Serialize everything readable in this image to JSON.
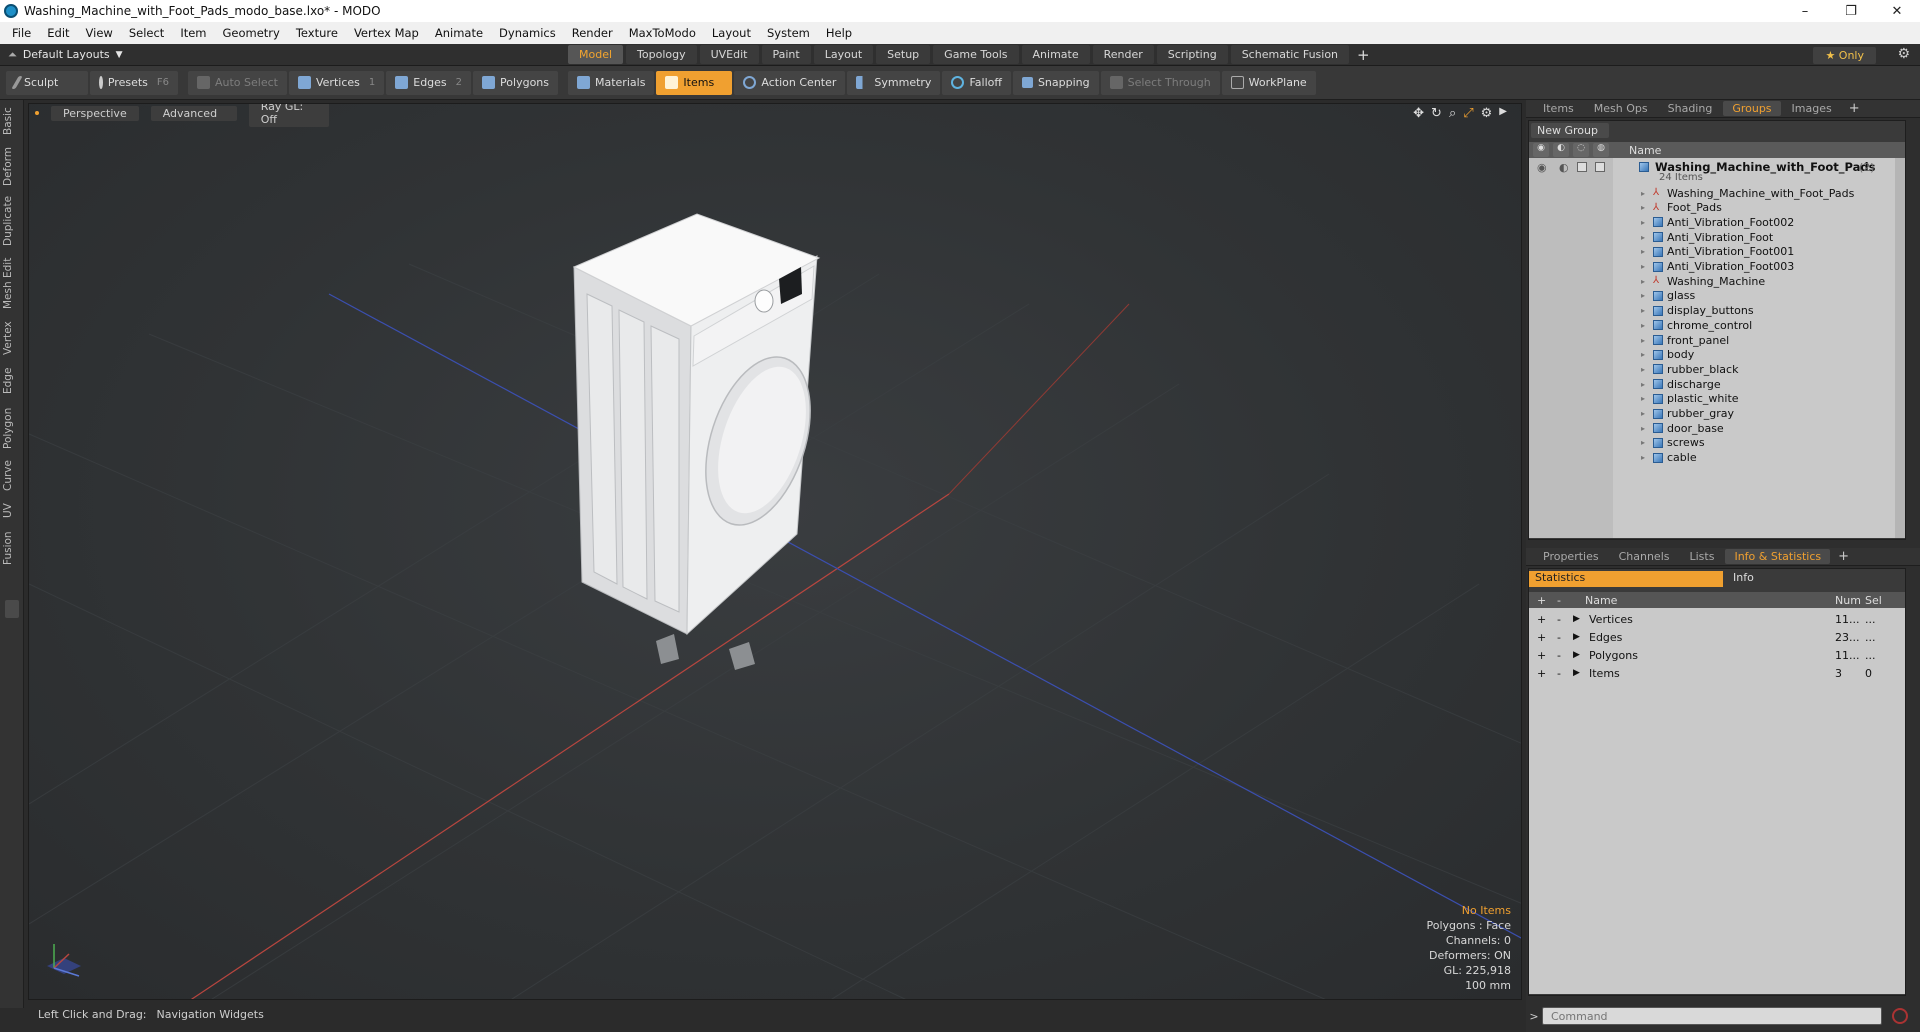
{
  "window": {
    "title": "Washing_Machine_with_Foot_Pads_modo_base.lxo* - MODO",
    "controls": [
      "–",
      "❐",
      "✕"
    ]
  },
  "menu": [
    "File",
    "Edit",
    "View",
    "Select",
    "Item",
    "Geometry",
    "Texture",
    "Vertex Map",
    "Animate",
    "Dynamics",
    "Render",
    "MaxToModo",
    "Layout",
    "System",
    "Help"
  ],
  "layoutbar": {
    "default_layouts": "Default Layouts",
    "tabs": [
      "Model",
      "Topology",
      "UVEdit",
      "Paint",
      "Layout",
      "Setup",
      "Game Tools",
      "Animate",
      "Render",
      "Scripting",
      "Schematic Fusion"
    ],
    "active_tab": "Model",
    "only_label": "★  Only"
  },
  "toolbar": {
    "sculpt": "Sculpt",
    "presets": "Presets",
    "presets_key": "F6",
    "auto_select": "Auto Select",
    "vertices": "Vertices",
    "vertices_key": "1",
    "edges": "Edges",
    "edges_key": "2",
    "polygons": "Polygons",
    "materials": "Materials",
    "items": "Items",
    "action_center": "Action Center",
    "symmetry": "Symmetry",
    "falloff": "Falloff",
    "snapping": "Snapping",
    "select_through": "Select Through",
    "workplane": "WorkPlane"
  },
  "left_tabs": [
    "Basic",
    "Deform",
    "Duplicate",
    "Mesh Edit",
    "Vertex",
    "Edge",
    "Polygon",
    "Curve",
    "UV",
    "Fusion"
  ],
  "viewport": {
    "perspective": "Perspective",
    "advanced": "Advanced",
    "raygl": "Ray GL: Off",
    "info": {
      "no_items": "No Items",
      "polygons": "Polygons : Face",
      "channels": "Channels: 0",
      "deformers": "Deformers: ON",
      "gl": "GL: 225,918",
      "scale": "100 mm"
    }
  },
  "statusbar": {
    "hint": "Left Click and Drag:",
    "action": "Navigation Widgets"
  },
  "groups_panel": {
    "tabs": [
      "Items",
      "Mesh Ops",
      "Shading",
      "Groups",
      "Images"
    ],
    "active_tab": "Groups",
    "new_group": "New Group",
    "column_name": "Name",
    "root": {
      "name": "Washing_Machine_with_Foot_Pads",
      "count": "(2)",
      "items_label": "24 Items"
    },
    "children": [
      {
        "name": "Washing_Machine_with_Foot_Pads",
        "icon": "locator-icon"
      },
      {
        "name": "Foot_Pads",
        "icon": "locator-icon"
      },
      {
        "name": "Anti_Vibration_Foot002",
        "icon": "mesh-icon"
      },
      {
        "name": "Anti_Vibration_Foot",
        "icon": "mesh-icon"
      },
      {
        "name": "Anti_Vibration_Foot001",
        "icon": "mesh-icon"
      },
      {
        "name": "Anti_Vibration_Foot003",
        "icon": "mesh-icon"
      },
      {
        "name": "Washing_Machine",
        "icon": "locator-icon"
      },
      {
        "name": "glass",
        "icon": "mesh-icon"
      },
      {
        "name": "display_buttons",
        "icon": "mesh-icon"
      },
      {
        "name": "chrome_control",
        "icon": "mesh-icon"
      },
      {
        "name": "front_panel",
        "icon": "mesh-icon"
      },
      {
        "name": "body",
        "icon": "mesh-icon"
      },
      {
        "name": "rubber_black",
        "icon": "mesh-icon"
      },
      {
        "name": "discharge",
        "icon": "mesh-icon"
      },
      {
        "name": "plastic_white",
        "icon": "mesh-icon"
      },
      {
        "name": "rubber_gray",
        "icon": "mesh-icon"
      },
      {
        "name": "door_base",
        "icon": "mesh-icon"
      },
      {
        "name": "screws",
        "icon": "mesh-icon"
      },
      {
        "name": "cable",
        "icon": "mesh-icon"
      }
    ]
  },
  "stats_panel": {
    "tabs": [
      "Properties",
      "Channels",
      "Lists",
      "Info & Statistics"
    ],
    "active_tab": "Info & Statistics",
    "subtabs": [
      "Statistics",
      "Info"
    ],
    "columns": {
      "name": "Name",
      "num": "Num",
      "sel": "Sel"
    },
    "rows": [
      {
        "name": "Vertices",
        "num": "11...",
        "sel": "..."
      },
      {
        "name": "Edges",
        "num": "23...",
        "sel": "..."
      },
      {
        "name": "Polygons",
        "num": "11...",
        "sel": "..."
      },
      {
        "name": "Items",
        "num": "3",
        "sel": "0"
      }
    ]
  },
  "command": {
    "placeholder": "Command"
  },
  "colors": {
    "accent": "#f0a030",
    "grid_x": "#b8463f",
    "grid_z": "#3b4fb0"
  }
}
